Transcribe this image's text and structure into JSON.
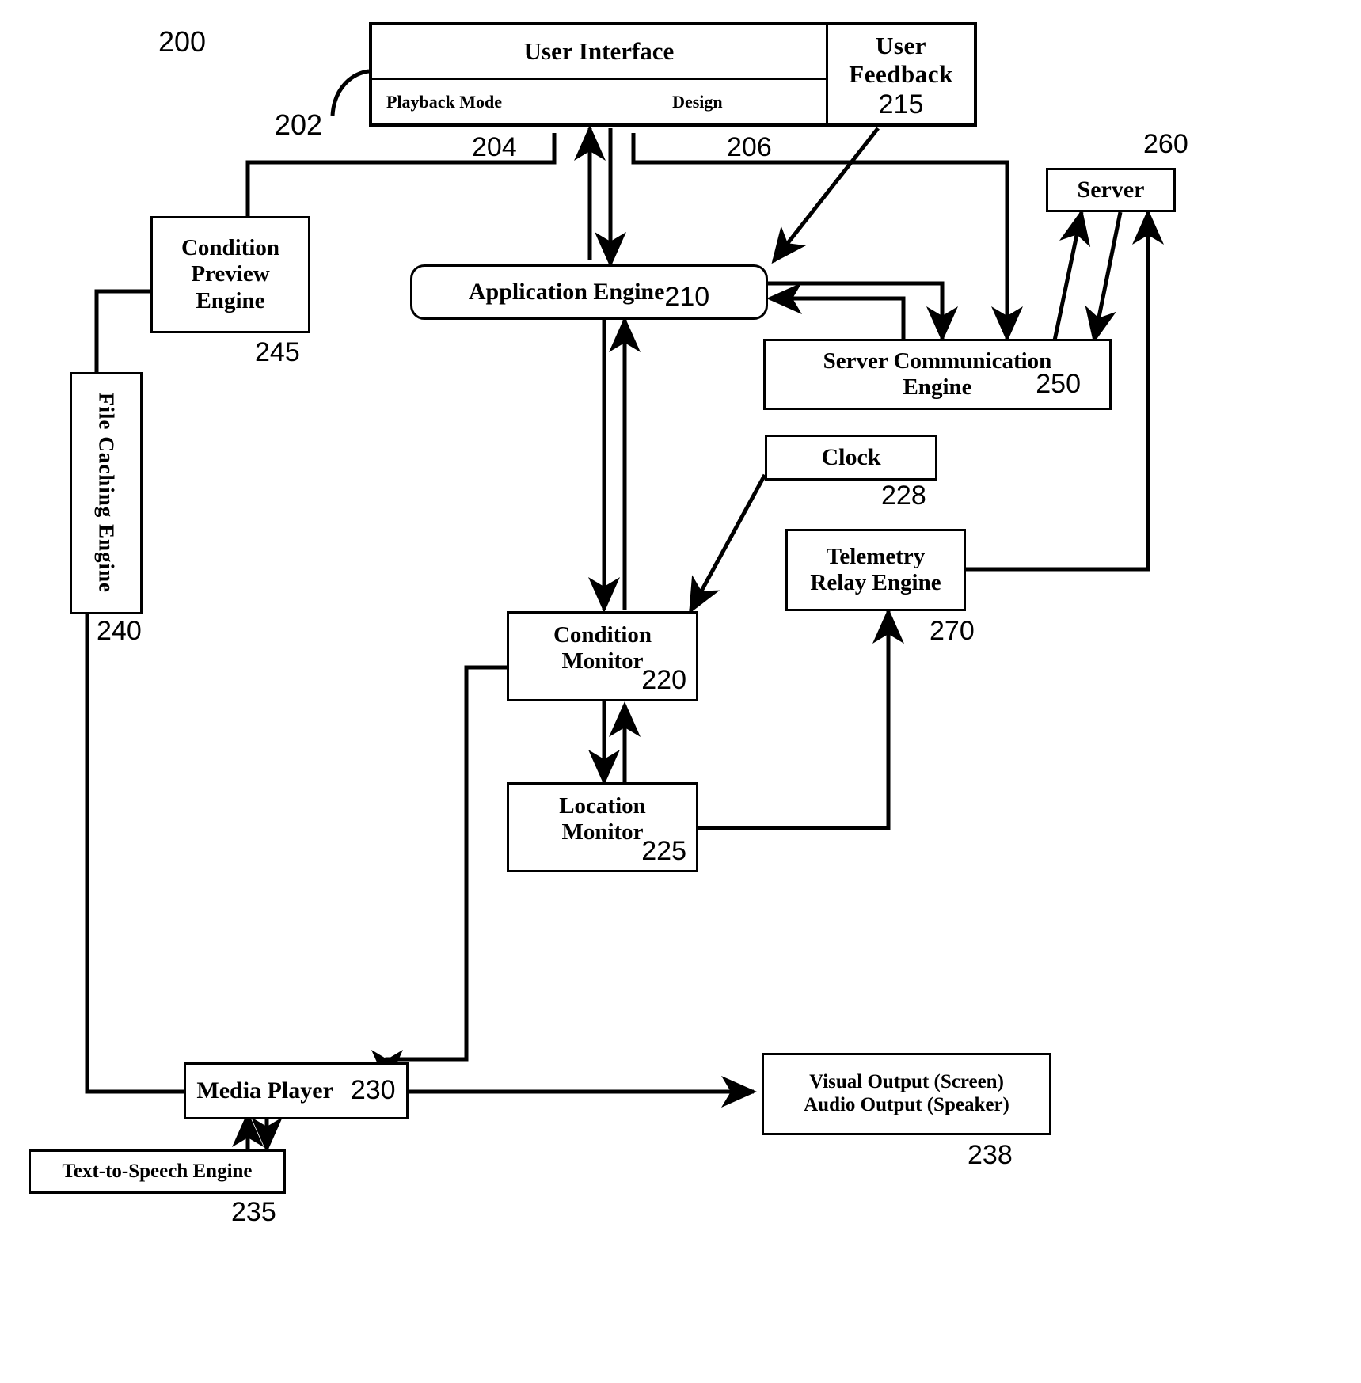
{
  "figure": {
    "figure_number": "200",
    "ui_callout": "202"
  },
  "blocks": {
    "user_interface": {
      "title": "User Interface",
      "mode_playback": "Playback Mode",
      "mode_design": "Design",
      "ref_playback": "204",
      "ref_design": "206"
    },
    "user_feedback": {
      "line1": "User",
      "line2": "Feedback",
      "ref": "215"
    },
    "condition_preview_engine": {
      "line1": "Condition",
      "line2": "Preview",
      "line3": "Engine",
      "ref": "245"
    },
    "file_caching_engine": {
      "title": "File Caching Engine",
      "ref": "240"
    },
    "application_engine": {
      "title": "Application Engine",
      "ref": "210"
    },
    "server": {
      "title": "Server",
      "ref": "260"
    },
    "server_communication_engine": {
      "line1": "Server Communication",
      "line2": "Engine",
      "ref": "250"
    },
    "clock": {
      "title": "Clock",
      "ref": "228"
    },
    "telemetry_relay_engine": {
      "line1": "Telemetry",
      "line2": "Relay Engine",
      "ref": "270"
    },
    "condition_monitor": {
      "line1": "Condition",
      "line2": "Monitor",
      "ref": "220"
    },
    "location_monitor": {
      "line1": "Location",
      "line2": "Monitor",
      "ref": "225"
    },
    "media_player": {
      "title": "Media Player",
      "ref": "230"
    },
    "text_to_speech_engine": {
      "title": "Text-to-Speech Engine",
      "ref": "235"
    },
    "output": {
      "line1": "Visual Output (Screen)",
      "line2": "Audio Output (Speaker)",
      "ref": "238"
    }
  },
  "colors": {
    "ink": "#000000",
    "paper": "#ffffff"
  }
}
